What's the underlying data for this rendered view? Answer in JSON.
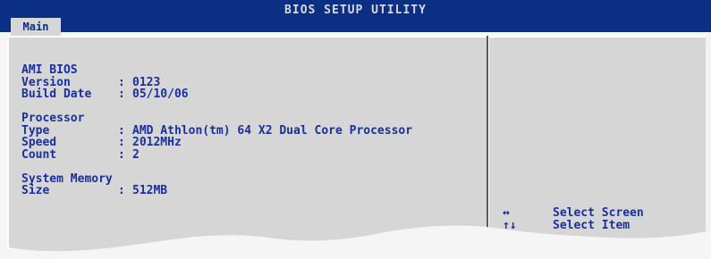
{
  "header": {
    "title": "BIOS SETUP UTILITY",
    "active_tab": "Main"
  },
  "bios": {
    "heading": "AMI BIOS",
    "version": {
      "label": "Version",
      "value": "0123"
    },
    "build_date": {
      "label": "Build Date",
      "value": "05/10/06"
    }
  },
  "processor": {
    "heading": "Processor",
    "type": {
      "label": "Type",
      "value": "AMD Athlon(tm) 64 X2 Dual Core Processor"
    },
    "speed": {
      "label": "Speed",
      "value": "2012MHz"
    },
    "count": {
      "label": "Count",
      "value": "2"
    }
  },
  "memory": {
    "heading": "System Memory",
    "size": {
      "label": "Size",
      "value": "512MB"
    }
  },
  "help": {
    "items": [
      {
        "key": "↔",
        "icon": "left-right-arrows-icon",
        "action": "Select Screen"
      },
      {
        "key": "↑↓",
        "icon": "up-down-arrows-icon",
        "action": "Select Item"
      }
    ]
  },
  "colors": {
    "title_bar": "#0b2f84",
    "panel": "#d6d6d6",
    "text": "#1a2f9c"
  }
}
